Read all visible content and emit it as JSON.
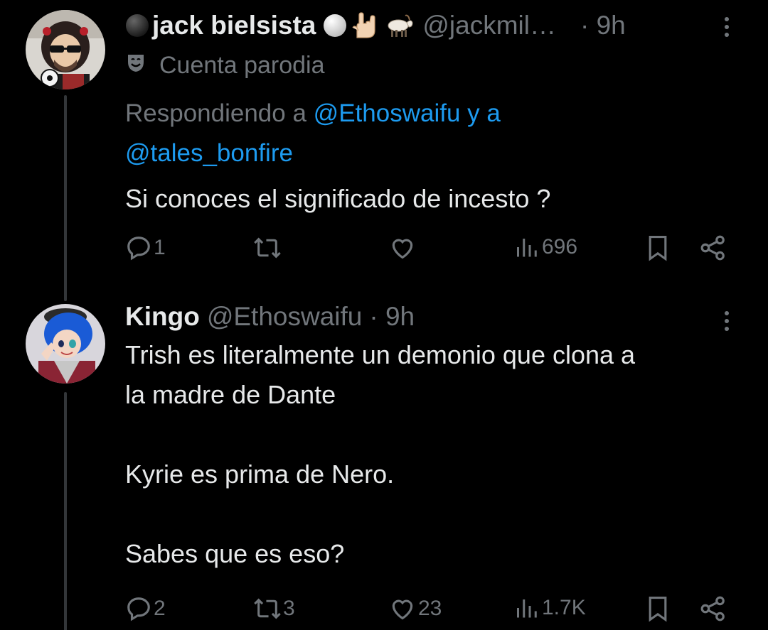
{
  "tweets": [
    {
      "author_name": "jack bielsista",
      "emoji_after_name": [
        "white-circle",
        "rock-on-hand",
        "goat"
      ],
      "handle": "@jackmil…",
      "time": "· 9h",
      "badge_label": "Cuenta parodia",
      "badge_icon": "theater-mask-icon",
      "reply_prefix": "Respondiendo a",
      "reply_mention_1": "@Ethoswaifu",
      "reply_joiner": "y a",
      "reply_mention_2": "@tales_bonfire",
      "text": "Si conoces el significado de incesto ?",
      "replies": "1",
      "reposts": "",
      "likes": "",
      "views": "696"
    },
    {
      "author_name": "Kingo",
      "handle": "@Ethoswaifu",
      "time": "· 9h",
      "text": "Trish es literalmente un demonio que clona a\nla madre de Dante\n\nKyrie es prima de Nero.\n\nSabes que es eso?",
      "replies": "2",
      "reposts": "3",
      "likes": "23",
      "views": "1.7K"
    }
  ],
  "colors": {
    "background": "#000000",
    "text": "#e7e9ea",
    "muted": "#71767b",
    "link": "#1d9bf0",
    "thread_line": "#333639"
  }
}
